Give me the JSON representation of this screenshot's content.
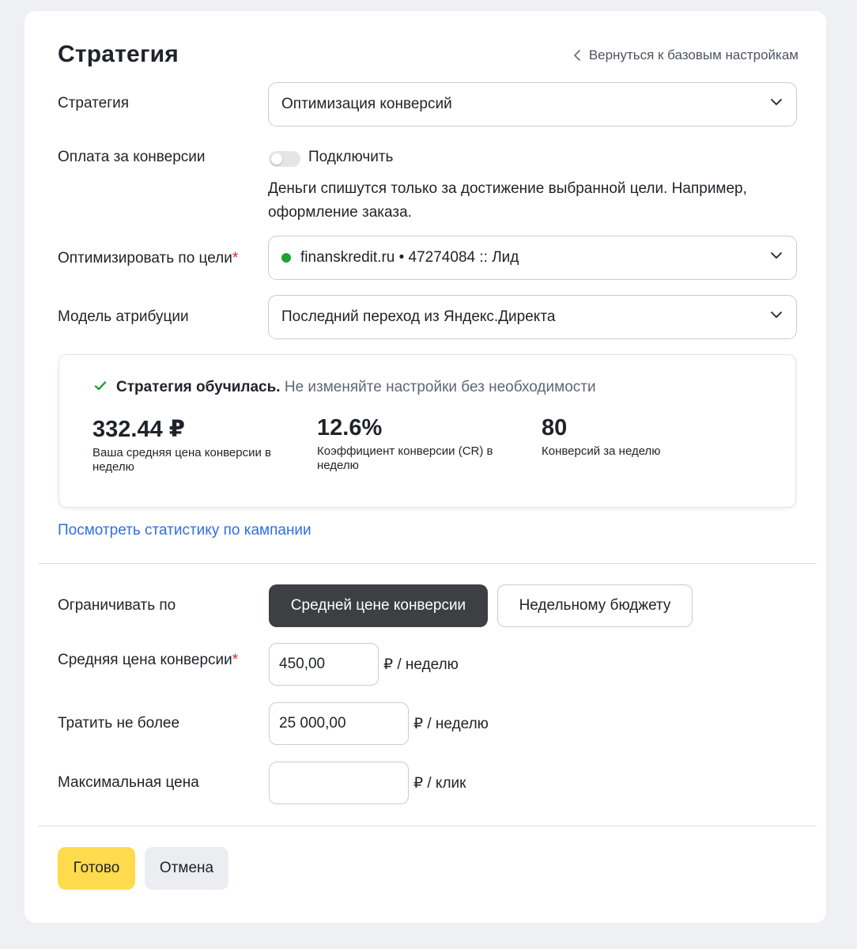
{
  "header": {
    "title": "Стратегия",
    "back_link": "Вернуться к базовым настройкам"
  },
  "strategy": {
    "label": "Стратегия",
    "value": "Оптимизация конверсий"
  },
  "pay_for_conversions": {
    "label": "Оплата за конверсии",
    "toggle_label": "Подключить",
    "enabled": false,
    "description": "Деньги спишутся только за достижение выбранной цели. Например, оформление заказа."
  },
  "goal": {
    "label": "Оптимизировать по цели",
    "required_mark": "*",
    "value": "finanskredit.ru • 47274084 :: Лид",
    "status_color": "#21a038"
  },
  "attribution": {
    "label": "Модель атрибуции",
    "value": "Последний переход из Яндекс.Директа"
  },
  "status": {
    "title": "Стратегия обучилась.",
    "message": "Не изменяйте настройки без необходимости",
    "metrics": [
      {
        "value": "332.44 ₽",
        "caption": "Ваша средняя цена конверсии в неделю"
      },
      {
        "value": "12.6%",
        "caption": "Коэффициент конверсии (CR) в неделю"
      },
      {
        "value": "80",
        "caption": "Конверсий за неделю"
      }
    ]
  },
  "stats_link": "Посмотреть статистику по кампании",
  "limit": {
    "label": "Ограничивать по",
    "options": [
      "Средней цене конверсии",
      "Недельному бюджету"
    ],
    "selected": "Средней цене конверсии"
  },
  "avg_cpa": {
    "label": "Средняя цена конверсии",
    "required_mark": "*",
    "value": "450,00",
    "unit": "₽ / неделю"
  },
  "budget": {
    "label": "Тратить не более",
    "value": "25 000,00",
    "unit": "₽ / неделю"
  },
  "max_price": {
    "label": "Максимальная цена",
    "value": "",
    "unit": "₽ / клик"
  },
  "actions": {
    "ready": "Готово",
    "cancel": "Отмена"
  },
  "colors": {
    "accent_yellow": "#ffdb4d",
    "link_blue": "#2f6fe4",
    "success_green": "#21a038",
    "active_segment": "#3d3f43"
  }
}
